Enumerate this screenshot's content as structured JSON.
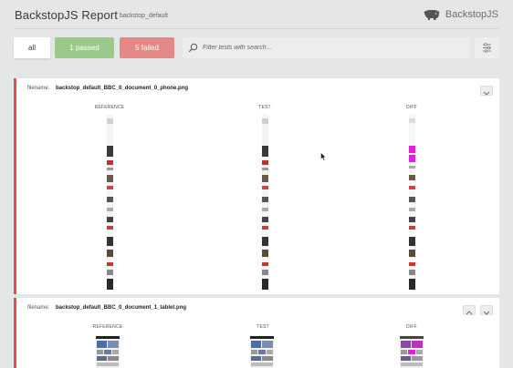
{
  "header": {
    "title": "BackstopJS Report",
    "subtitle": "backstop_default",
    "brand": "BackstopJS",
    "logo_icon": "bison-logo-icon"
  },
  "filters": {
    "all_label": "all",
    "passed_label": "1 passed",
    "failed_label": "5 failed",
    "passed_color": "#9ac98a",
    "failed_color": "#e48888"
  },
  "search": {
    "placeholder": "Filter tests with search...",
    "value": "",
    "icon": "search-icon"
  },
  "settings": {
    "icon": "sliders-icon"
  },
  "tests": [
    {
      "filename_label": "filename:",
      "filename": "backstop_default_BBC_0_document_0_phone.png",
      "columns": [
        "REFERENCE",
        "TEST",
        "DIFF"
      ],
      "status_color": "#e34f4f"
    },
    {
      "filename_label": "filename:",
      "filename": "backstop_default_BBC_0_document_1_tablet.png",
      "columns": [
        "REFERENCE",
        "TEST",
        "DIFF"
      ],
      "status_color": "#e34f4f"
    }
  ]
}
